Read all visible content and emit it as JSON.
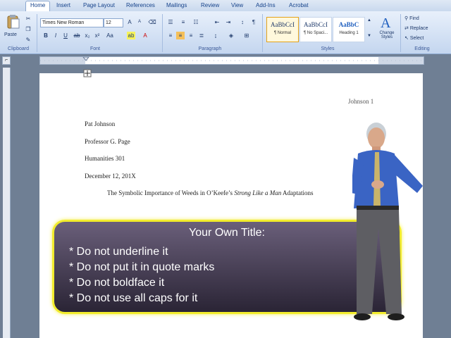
{
  "ribbon": {
    "tabs": [
      "Home",
      "Insert",
      "Page Layout",
      "References",
      "Mailings",
      "Review",
      "View",
      "Add-Ins",
      "Acrobat"
    ],
    "clipboard": {
      "paste_label": "Paste",
      "group_label": "Clipboard"
    },
    "font": {
      "font_name": "Times New Roman",
      "font_size": "12",
      "group_label": "Font"
    },
    "paragraph": {
      "group_label": "Paragraph"
    },
    "styles": {
      "items": [
        {
          "sample": "AaBbCcI",
          "name": "¶ Normal"
        },
        {
          "sample": "AaBbCcI",
          "name": "¶ No Spaci..."
        },
        {
          "sample": "AaBbC",
          "name": "Heading 1"
        }
      ],
      "change_styles_label": "Change Styles",
      "group_label": "Styles"
    },
    "editing": {
      "find_label": "Find",
      "replace_label": "Replace",
      "select_label": "Select",
      "group_label": "Editing"
    }
  },
  "document": {
    "header": "Johnson 1",
    "lines": [
      "Pat Johnson",
      "Professor G. Page",
      "Humanities 301",
      "December 12, 201X"
    ],
    "title_pre": "The Symbolic Importance of Weeds in O’Keefe’s",
    "title_italic": "Strong Like a Man",
    "title_post": "Adaptations"
  },
  "callout": {
    "title": "Your Own Title:",
    "bullets": [
      "* Do not underline it",
      "* Do not put it in quote marks",
      "* Do not boldface it",
      "* Do not use all caps for it"
    ]
  },
  "colors": {
    "callout_border": "#f2ec2c",
    "ribbon_text": "#15428b"
  }
}
